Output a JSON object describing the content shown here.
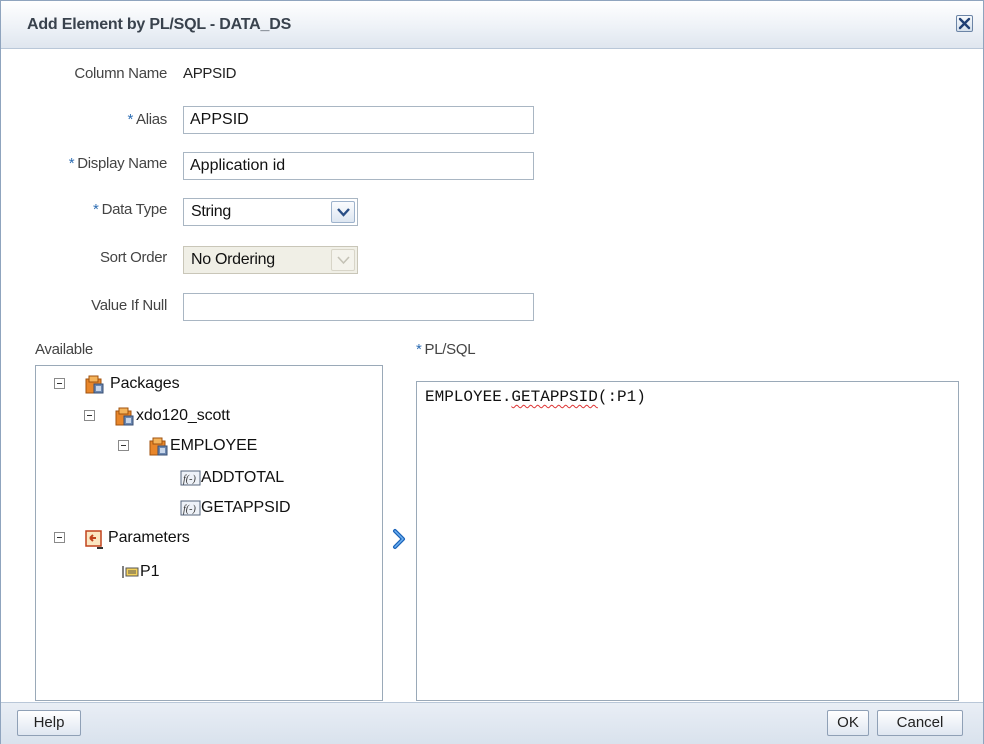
{
  "dialog": {
    "title": "Add Element by PL/SQL - DATA_DS"
  },
  "form": {
    "column_name_label": "Column Name",
    "column_name_value": "APPSID",
    "alias_label": "Alias",
    "alias_value": "APPSID",
    "display_name_label": "Display Name",
    "display_name_value": "Application id",
    "data_type_label": "Data Type",
    "data_type_value": "String",
    "sort_order_label": "Sort Order",
    "sort_order_value": "No Ordering",
    "value_if_null_label": "Value If Null",
    "value_if_null_value": "",
    "required_marker": "*"
  },
  "available": {
    "label": "Available",
    "tree": [
      {
        "label": "Packages",
        "icon": "package-icon",
        "expanded": true
      },
      {
        "label": "xdo120_scott",
        "icon": "package-icon",
        "expanded": true
      },
      {
        "label": "EMPLOYEE",
        "icon": "package-icon",
        "expanded": true
      },
      {
        "label": "ADDTOTAL",
        "icon": "function-icon"
      },
      {
        "label": "GETAPPSID",
        "icon": "function-icon"
      },
      {
        "label": "Parameters",
        "icon": "parameters-icon",
        "expanded": true
      },
      {
        "label": "P1",
        "icon": "parameter-icon"
      }
    ]
  },
  "plsql": {
    "label": "PL/SQL",
    "code_prefix": "EMPLOYEE.",
    "code_flagged": "GETAPPSID",
    "code_suffix": "(:P1)"
  },
  "buttons": {
    "help": "Help",
    "ok": "OK",
    "cancel": "Cancel"
  },
  "colors": {
    "required_star": "#2d6db3",
    "titlebar": "#dfe6ef",
    "footer": "#d9e2ed"
  }
}
